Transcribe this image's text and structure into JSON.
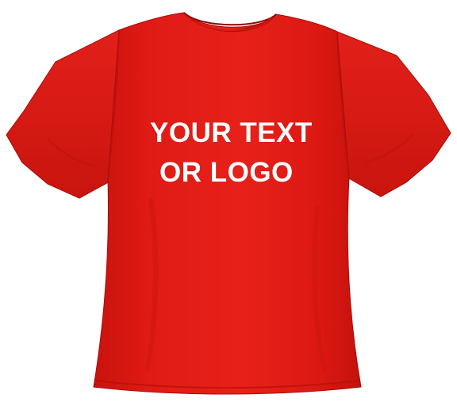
{
  "product": {
    "shirt_color": "#e41b17",
    "print_color": "#ffffff",
    "print_lines": [
      "YOUR TEXT",
      "OR LOGO"
    ]
  }
}
